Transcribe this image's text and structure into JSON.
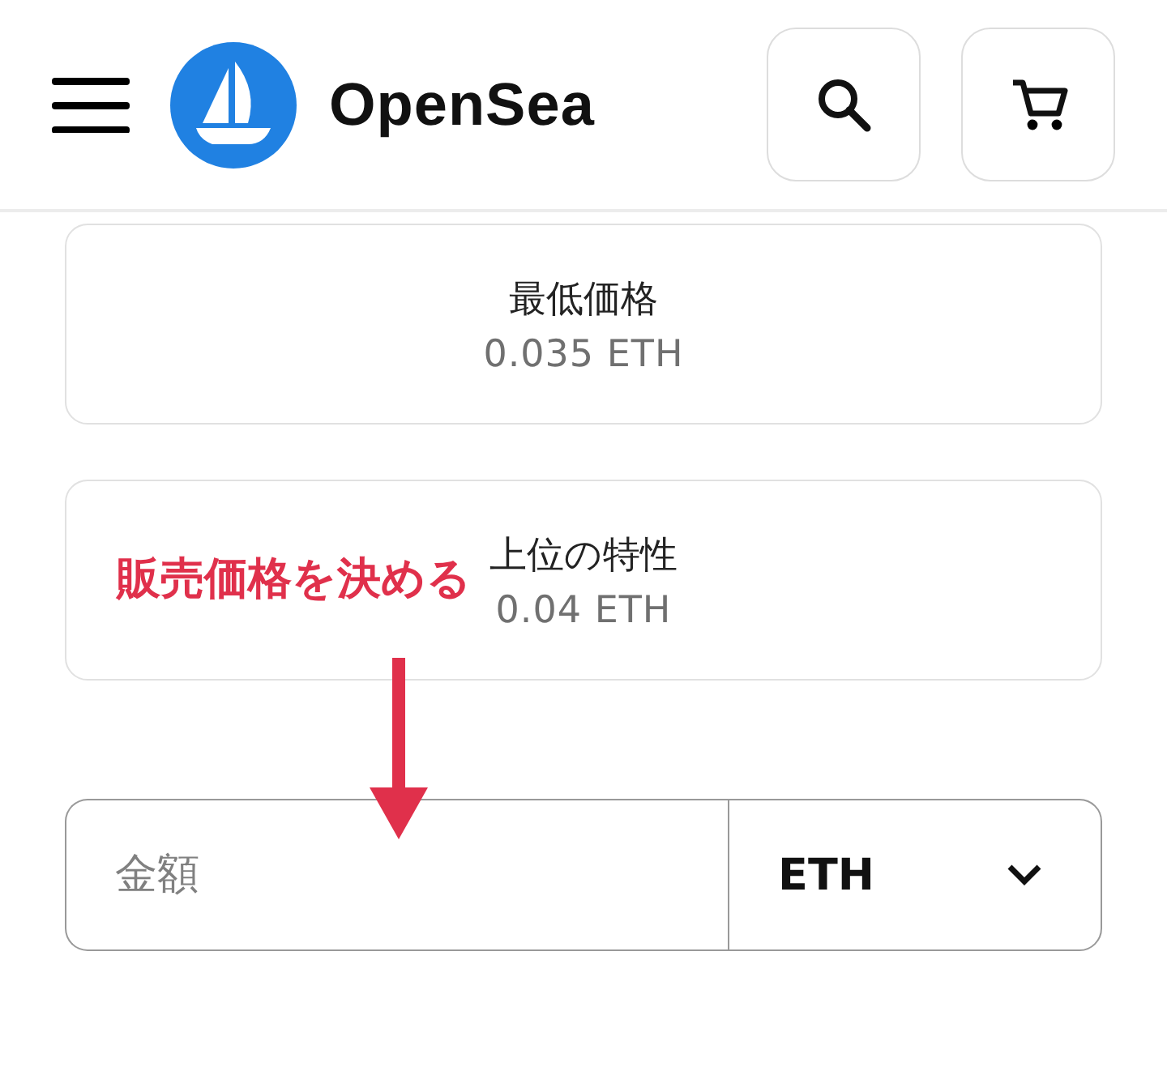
{
  "header": {
    "logo_text": "OpenSea"
  },
  "stats": [
    {
      "label": "最低価格",
      "value": "0.035 ETH"
    },
    {
      "label": "上位の特性",
      "value": "0.04 ETH"
    }
  ],
  "price_input": {
    "placeholder": "金額",
    "currency": "ETH"
  },
  "annotation": {
    "text": "販売価格を決める"
  }
}
